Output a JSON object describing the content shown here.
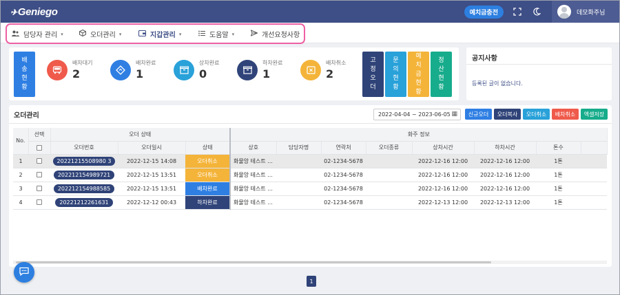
{
  "header": {
    "logo_text": "Geniego",
    "deposit_button": "예치금충전",
    "user_name": "데모화주님"
  },
  "nav": {
    "items": [
      {
        "label": "담당자 관리",
        "icon": "users-icon"
      },
      {
        "label": "오더관리",
        "icon": "cube-icon"
      },
      {
        "label": "지갑관리",
        "icon": "wallet-icon"
      },
      {
        "label": "도움말",
        "icon": "list-icon"
      },
      {
        "label": "개선요청사항",
        "icon": "send-icon"
      }
    ]
  },
  "status": {
    "dispatch_status_button": "배송현황",
    "stats": [
      {
        "label": "배차대기",
        "value": "2",
        "color": "#ef5a4b",
        "icon": "truck-icon"
      },
      {
        "label": "배차완료",
        "value": "1",
        "color": "#2f7fe3",
        "icon": "diamond-icon"
      },
      {
        "label": "상차완료",
        "value": "0",
        "color": "#29a1d9",
        "icon": "box-icon"
      },
      {
        "label": "하차완료",
        "value": "1",
        "color": "#30447a",
        "icon": "box-icon"
      },
      {
        "label": "배차취소",
        "value": "2",
        "color": "#f4b43a",
        "icon": "cancel-icon"
      }
    ],
    "side_buttons": [
      {
        "label": "고정오더",
        "color": "#2f4378"
      },
      {
        "label": "문의현황",
        "color": "#29a1d9"
      },
      {
        "label": "예치금현황",
        "color": "#f4b43a"
      },
      {
        "label": "정산현황",
        "color": "#17ac8b"
      }
    ]
  },
  "notice": {
    "title": "공지사항",
    "empty_text": "등록된 글이 없습니다."
  },
  "orders": {
    "title": "오더관리",
    "date_range": "2022-04-04 ~ 2023-06-05",
    "actions": [
      {
        "label": "신규오더",
        "color": "#2f7fe3"
      },
      {
        "label": "오더복사",
        "color": "#2f4378"
      },
      {
        "label": "오더취소",
        "color": "#29a1d9"
      },
      {
        "label": "배차취소",
        "color": "#ef5a4b"
      },
      {
        "label": "엑셀저장",
        "color": "#17ac8b"
      }
    ],
    "group_headers": {
      "no": "No.",
      "select": "선택",
      "order_status": "오더 상태",
      "shipper_info": "화주 정보"
    },
    "columns": {
      "order_no": "오더번호",
      "order_date": "오더일시",
      "status": "상태",
      "company": "상호",
      "manager": "담당자명",
      "contact": "연락처",
      "order_type": "오더종류",
      "load_time": "상차시간",
      "unload_time": "하차시간",
      "tonnage": "톤수"
    },
    "rows": [
      {
        "no": "1",
        "order_no": "20221215508980 3",
        "order_date": "2022-12-15 14:08",
        "status": "오더취소",
        "status_color": "#f4b43a",
        "company": "화물앙 테스트 ...",
        "manager": "",
        "contact": "02-1234-5678",
        "order_type": "",
        "load_time": "2022-12-16 12:00",
        "unload_time": "2022-12-16 12:00",
        "tonnage": "1톤"
      },
      {
        "no": "2",
        "order_no": "202212154989721",
        "order_date": "2022-12-15 13:51",
        "status": "오더취소",
        "status_color": "#f4b43a",
        "company": "화물앙 테스트 ...",
        "manager": "",
        "contact": "02-1234-5678",
        "order_type": "",
        "load_time": "2022-12-16 12:00",
        "unload_time": "2022-12-16 12:00",
        "tonnage": "1톤"
      },
      {
        "no": "3",
        "order_no": "202212154988585",
        "order_date": "2022-12-15 13:51",
        "status": "배차완료",
        "status_color": "#2f7fe3",
        "company": "화물앙 테스트 ...",
        "manager": "",
        "contact": "02-1234-5678",
        "order_type": "",
        "load_time": "2022-12-16 12:00",
        "unload_time": "2022-12-16 12:00",
        "tonnage": "1톤"
      },
      {
        "no": "4",
        "order_no": "20221212261631",
        "order_date": "2022-12-12 00:43",
        "status": "하차완료",
        "status_color": "#30447a",
        "company": "화물앙 테스트 ...",
        "manager": "",
        "contact": "02-1234-5678",
        "order_type": "",
        "load_time": "2022-12-13 12:00",
        "unload_time": "2022-12-13 12:00",
        "tonnage": "1톤"
      }
    ]
  },
  "pagination": {
    "current": "1"
  }
}
